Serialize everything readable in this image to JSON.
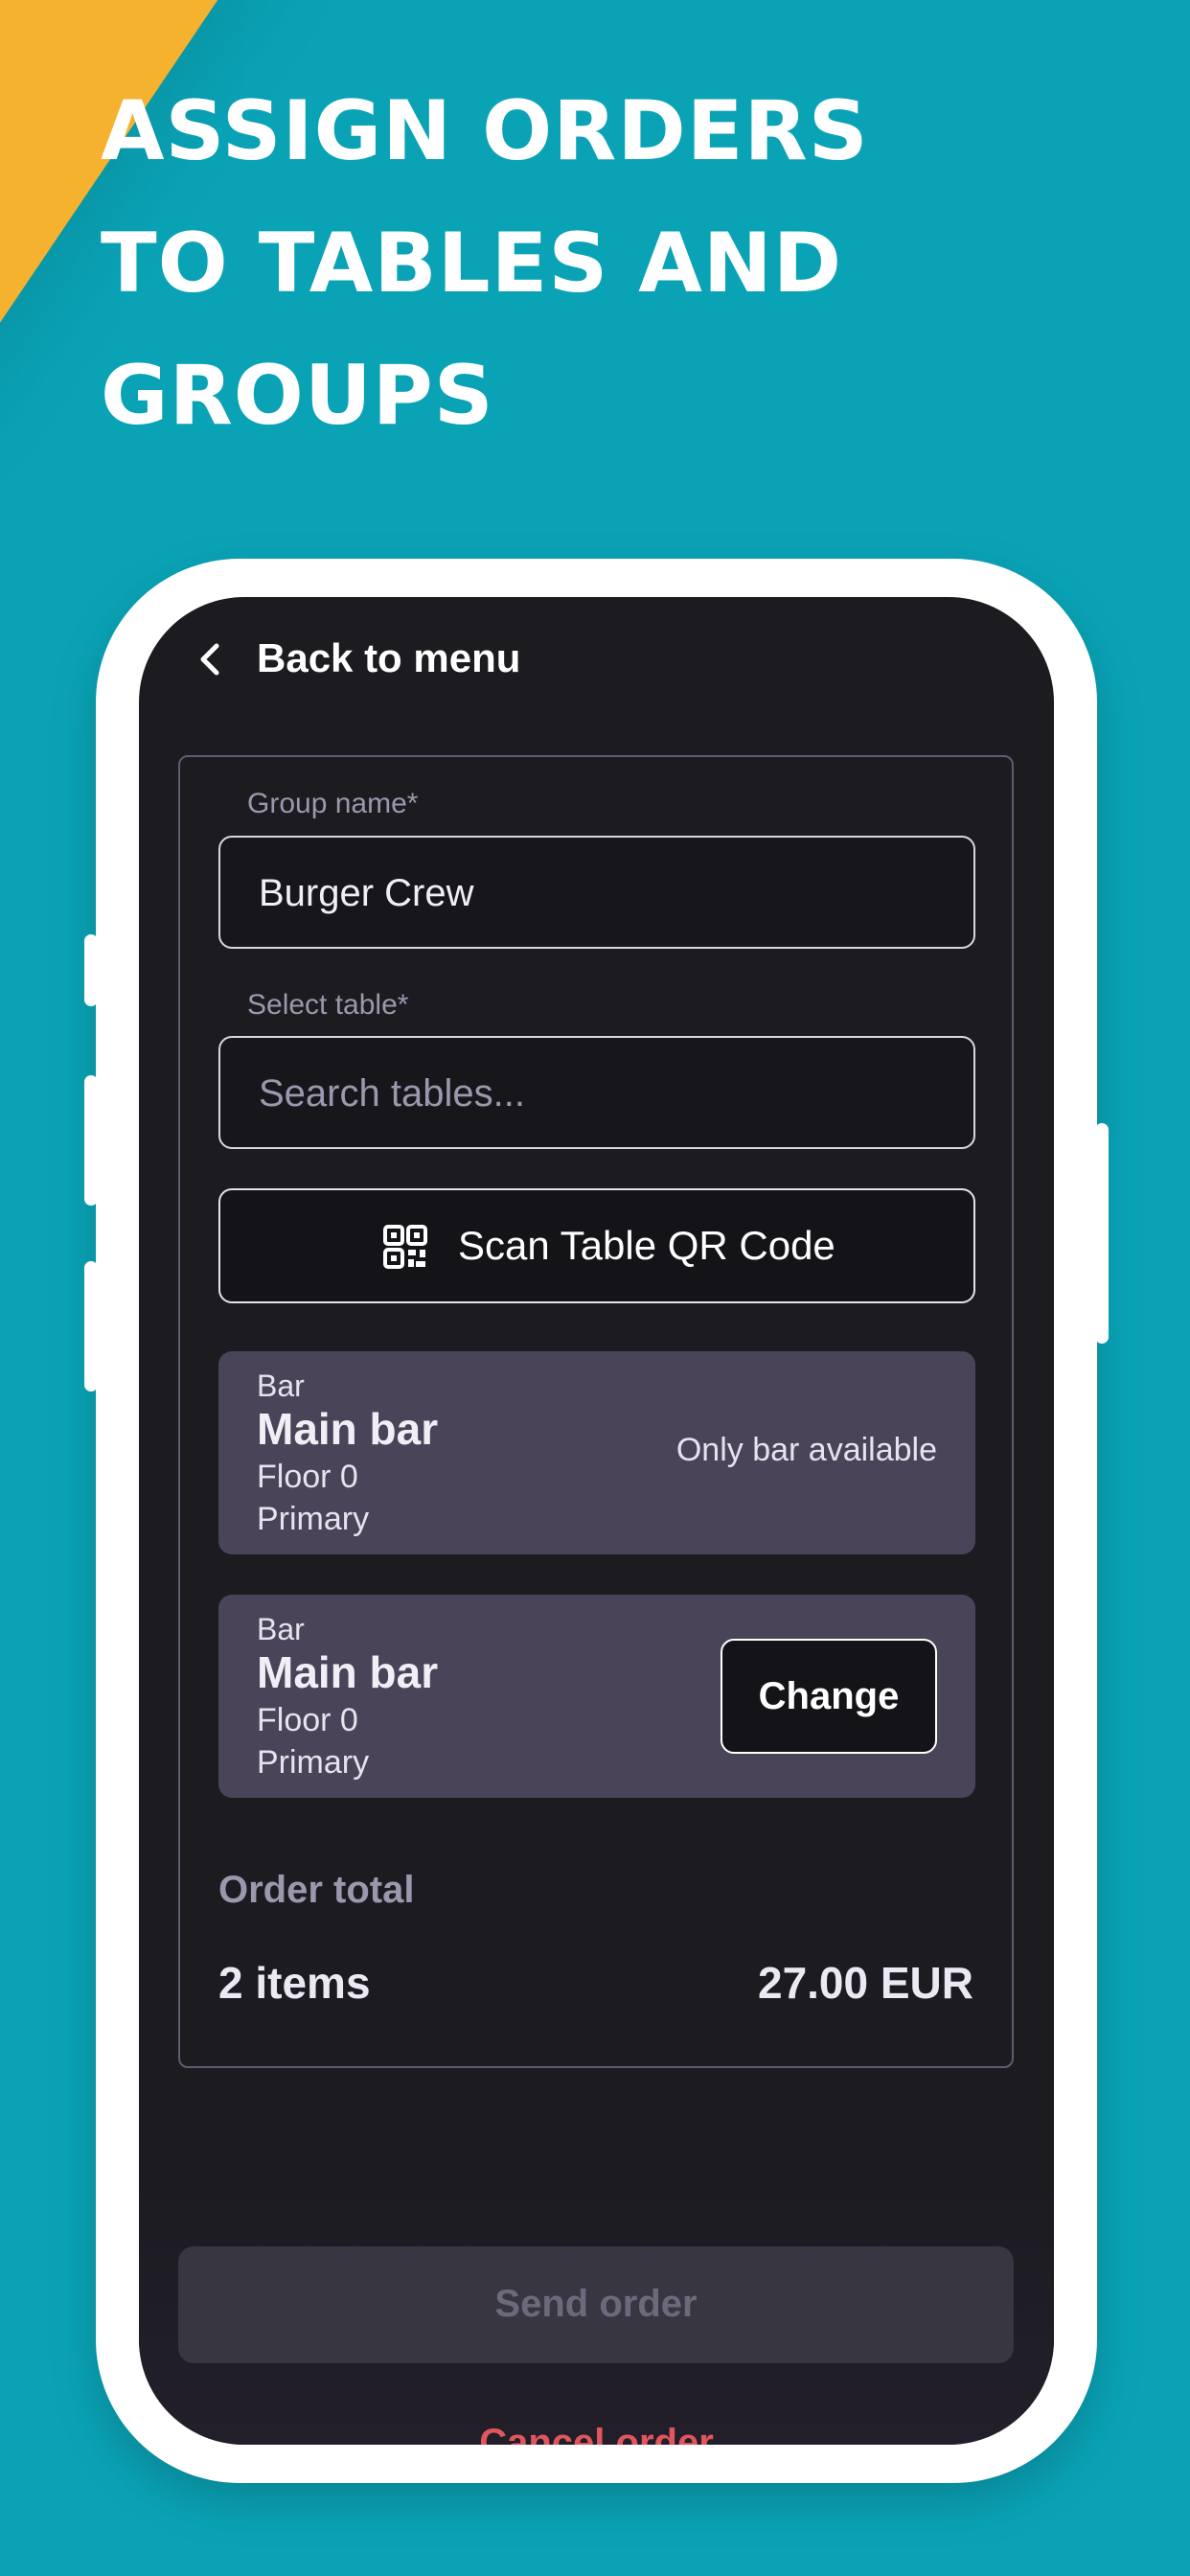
{
  "headline": [
    "ASSIGN ORDERS",
    "TO TABLES AND",
    "GROUPS"
  ],
  "colors": {
    "background": "#0aa3b6",
    "accent_stripe": "#f5b22e",
    "screen": "#1b1b20",
    "table_card": "#4a4458",
    "cancel": "#e0565c"
  },
  "header": {
    "back_label": "Back to menu",
    "back_icon": "chevron-left-icon"
  },
  "form": {
    "group_label": "Group name*",
    "group_value": "Burger Crew",
    "table_label": "Select table*",
    "table_placeholder": "Search tables...",
    "scan_label": "Scan Table QR Code",
    "scan_icon": "qr-code-icon"
  },
  "tables": [
    {
      "type": "Bar",
      "name": "Main bar",
      "floor": "Floor 0",
      "tag": "Primary",
      "note": "Only bar available"
    },
    {
      "type": "Bar",
      "name": "Main bar",
      "floor": "Floor 0",
      "tag": "Primary",
      "action": "Change"
    }
  ],
  "order": {
    "total_label": "Order total",
    "items": "2 items",
    "amount": "27.00 EUR"
  },
  "footer": {
    "send_label": "Send order",
    "cancel_label": "Cancel order"
  }
}
